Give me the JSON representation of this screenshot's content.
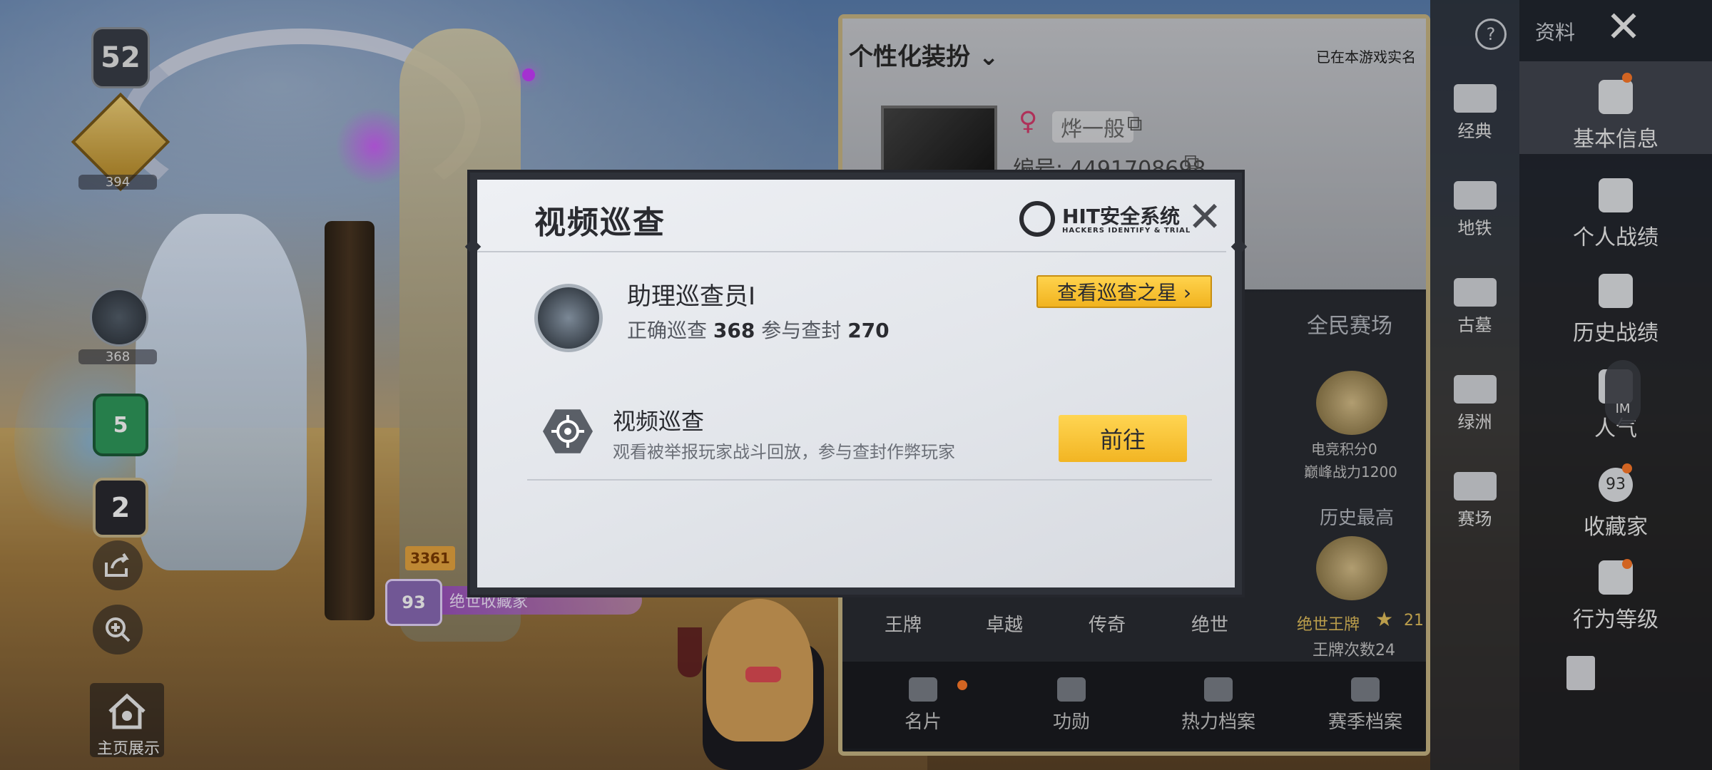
{
  "left": {
    "level": "52",
    "rank_count": "394",
    "scope_count": "368",
    "green_badge": "5",
    "number_badge": "2",
    "home_label": "主页展示",
    "power_tag": "3361",
    "collector_badge": "93",
    "collector_text": "绝世收藏家"
  },
  "profile": {
    "customize_label": "个性化装扮",
    "realname_note": "已在本游戏实名",
    "nickname": "烨一般",
    "player_id": "编号: 4491708698",
    "public_arena": "全民赛场",
    "esports_score": "电竞积分0",
    "peak_power": "巅峰战力1200",
    "history_best": "历史最高",
    "best_rank": "绝世王牌",
    "best_stars": "21",
    "ace_count": "王牌次数24",
    "rank_tiers": [
      "王牌",
      "卓越",
      "传奇",
      "绝世"
    ],
    "bottom_tabs": [
      "名片",
      "功勋",
      "热力档案",
      "赛季档案"
    ]
  },
  "side1": {
    "items": [
      "经典",
      "地铁",
      "古墓",
      "绿洲",
      "赛场"
    ]
  },
  "side2": {
    "header": "资料",
    "items": [
      "基本信息",
      "个人战绩",
      "历史战绩",
      "人气",
      "收藏家",
      "行为等级"
    ],
    "im_label": "IM",
    "collector_level": "93"
  },
  "modal": {
    "title": "视频巡查",
    "brand": "HIT安全系统",
    "brand_sub": "HACKERS IDENTIFY & TRIAL",
    "rank_title": "助理巡查员I",
    "correct_label": "正确巡查",
    "correct_value": "368",
    "ban_label": "参与查封",
    "ban_value": "270",
    "star_button": "查看巡查之星 ›",
    "patrol_title": "视频巡查",
    "patrol_desc": "观看被举报玩家战斗回放，参与查封作弊玩家",
    "go_button": "前往"
  }
}
